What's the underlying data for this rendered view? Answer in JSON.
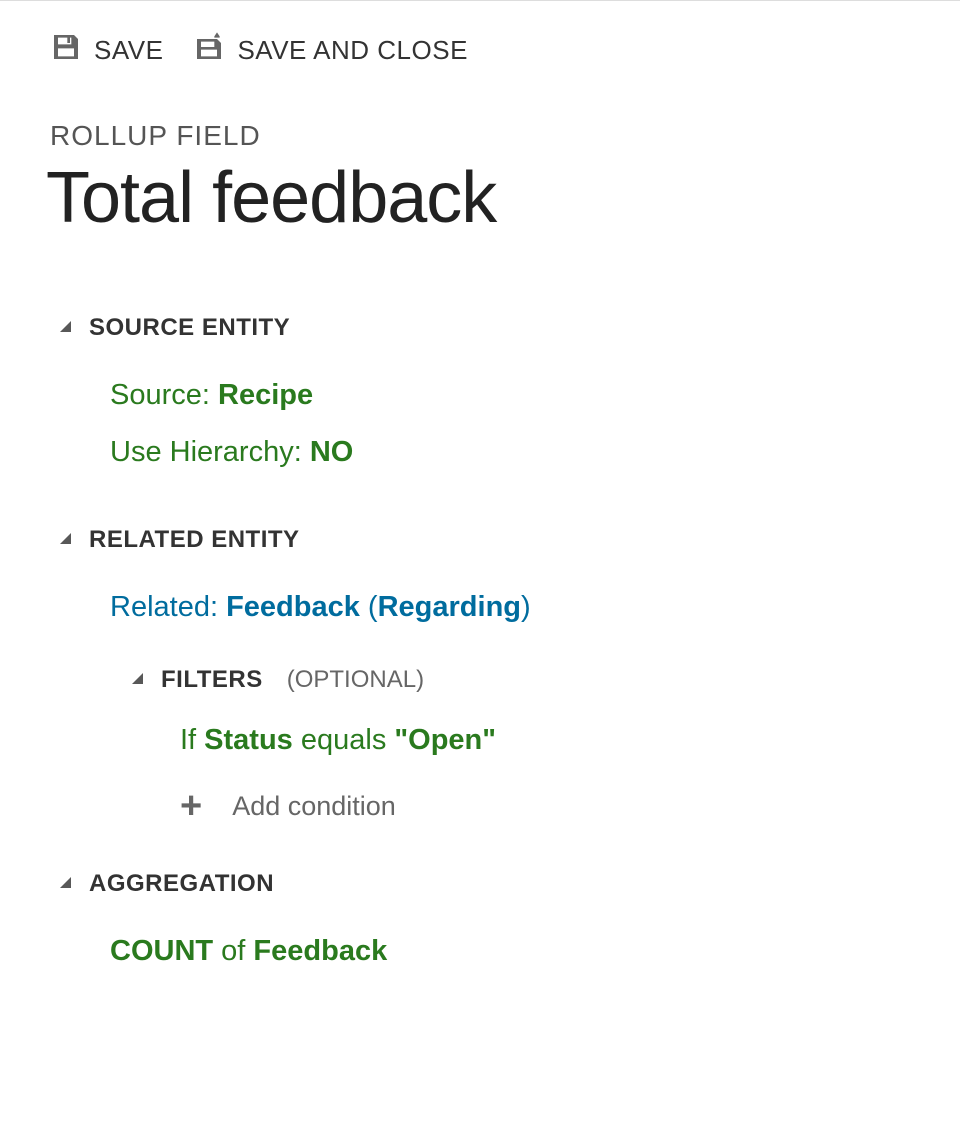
{
  "toolbar": {
    "save": "SAVE",
    "saveClose": "SAVE AND CLOSE"
  },
  "page": {
    "subtitle": "ROLLUP FIELD",
    "title": "Total feedback"
  },
  "sections": {
    "source": {
      "header": "SOURCE ENTITY",
      "sourceLabel": "Source: ",
      "sourceValue": "Recipe",
      "hierLabel": "Use Hierarchy: ",
      "hierValue": "NO"
    },
    "related": {
      "header": "RELATED ENTITY",
      "relLabel": "Related: ",
      "relValue": "Feedback ",
      "relParenOpen": "(",
      "relValue2": "Regarding",
      "relParenClose": ")",
      "filters": {
        "header": "FILTERS",
        "optional": "(OPTIONAL)",
        "condIf": "If ",
        "condField": "Status",
        "condOp": " equals ",
        "condVal": "\"Open\"",
        "addLabel": "Add condition"
      }
    },
    "agg": {
      "header": "AGGREGATION",
      "op": "COUNT",
      "of": " of ",
      "entity": "Feedback"
    }
  }
}
